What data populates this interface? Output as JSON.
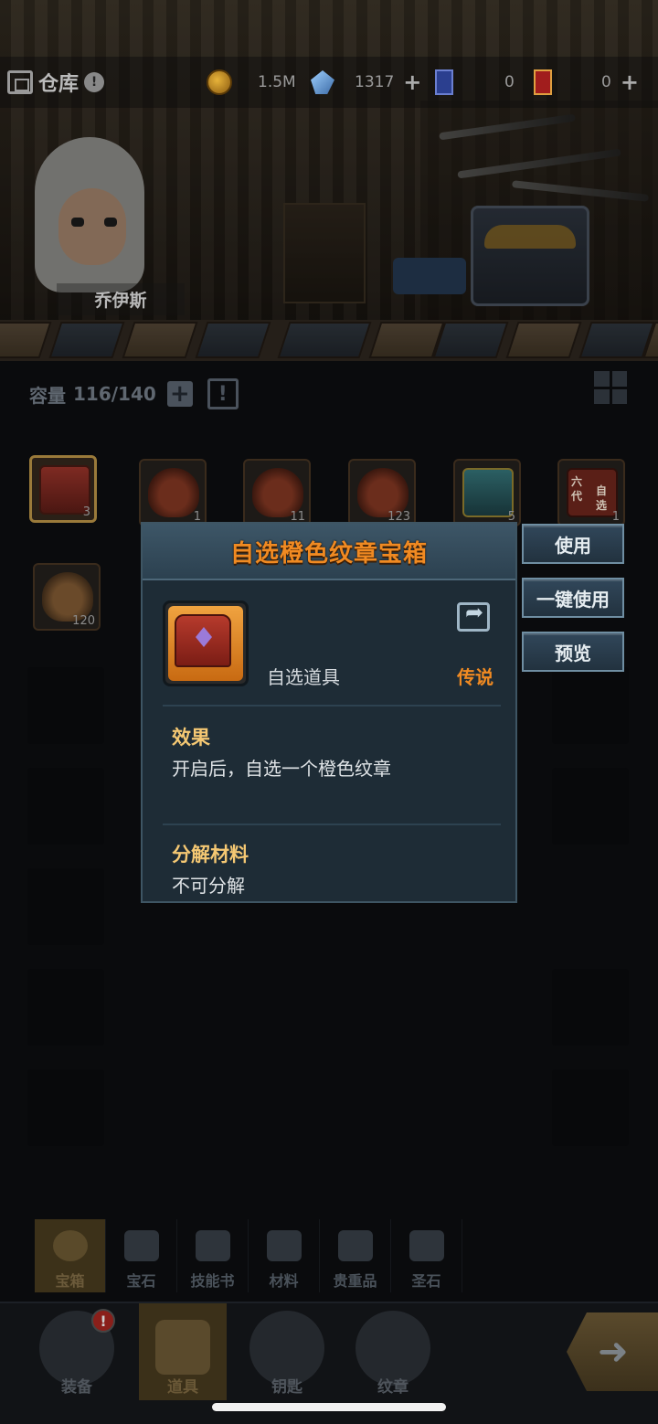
{
  "topbar": {
    "title": "仓库",
    "info": "!",
    "resources": [
      {
        "name": "gold",
        "icon": "coin-icon",
        "value": "1.5M"
      },
      {
        "name": "diamond",
        "icon": "crystal-icon",
        "value": "1317",
        "plus": "+"
      },
      {
        "name": "blue-card",
        "icon": "blue-card-icon",
        "value": "0"
      },
      {
        "name": "red-card",
        "icon": "red-card-icon",
        "value": "0",
        "plus": "+"
      }
    ]
  },
  "hero": {
    "name": "乔伊斯"
  },
  "capacity": {
    "label": "容量",
    "value": "116/140",
    "plus": "+",
    "alert": "!"
  },
  "inventory": {
    "row1": [
      {
        "icon": "orange-chest-icon",
        "count": "3",
        "selected": true
      },
      {
        "icon": "clay-pot-icon",
        "count": "1"
      },
      {
        "icon": "clay-pot-icon",
        "count": "11"
      },
      {
        "icon": "clay-pot-icon",
        "count": "123"
      },
      {
        "icon": "teal-chest-icon",
        "count": "5"
      },
      {
        "icon": "tag-chest-icon",
        "count": "1",
        "tag_lines": [
          "六",
          "代",
          "自",
          "选"
        ]
      }
    ],
    "row2": [
      {
        "icon": "bronze-jar-icon",
        "count": "120"
      }
    ]
  },
  "popup": {
    "title": "自选橙色纹章宝箱",
    "item_type": "自选道具",
    "rarity": "传说",
    "effect_title": "效果",
    "effect_text": "开启后，自选一个橙色纹章",
    "decompose_title": "分解材料",
    "decompose_text": "不可分解"
  },
  "side_buttons": {
    "use": "使用",
    "use_all": "一键使用",
    "preview": "预览"
  },
  "category_tabs": [
    {
      "label": "宝箱",
      "icon": "chest-icon",
      "active": true
    },
    {
      "label": "宝石",
      "icon": "gem-icon"
    },
    {
      "label": "技能书",
      "icon": "book-icon"
    },
    {
      "label": "材料",
      "icon": "material-icon"
    },
    {
      "label": "贵重品",
      "icon": "valuable-icon"
    },
    {
      "label": "圣石",
      "icon": "holy-stone-icon"
    }
  ],
  "bottom_nav": [
    {
      "label": "装备",
      "icon": "equipment-icon",
      "badge": "!"
    },
    {
      "label": "道具",
      "icon": "items-icon",
      "active": true
    },
    {
      "label": "钥匙",
      "icon": "key-icon"
    },
    {
      "label": "纹章",
      "icon": "emblem-icon"
    }
  ],
  "colors": {
    "rarity_orange": "#f08a22",
    "section_gold": "#f5c873",
    "popup_bg": "#1e2c36",
    "button_border": "#6f8ea2"
  }
}
